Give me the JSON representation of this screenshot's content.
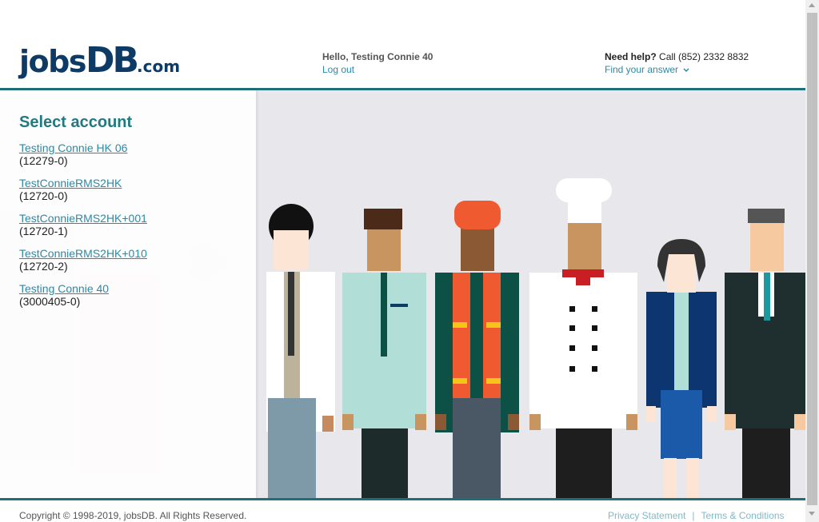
{
  "header": {
    "logo_parts": [
      "jobs",
      "DB",
      ".com"
    ],
    "greeting": "Hello, Testing Connie 40",
    "logout": "Log out",
    "help_label": "Need help?",
    "help_phone": "Call (852) 2332 8832",
    "find_answer": "Find your answer",
    "chevron_icon": "chevron-down-icon"
  },
  "panel": {
    "title": "Select account",
    "accounts": [
      {
        "name": "Testing Connie HK 06",
        "id": "(12279-0)"
      },
      {
        "name": "TestConnieRMS2HK",
        "id": "(12720-0)"
      },
      {
        "name": "TestConnieRMS2HK+001",
        "id": "(12720-1)"
      },
      {
        "name": "TestConnieRMS2HK+010",
        "id": "(12720-2)"
      },
      {
        "name": "Testing Connie 40",
        "id": "(3000405-0)"
      }
    ]
  },
  "footer": {
    "copyright": "Copyright © 1998-2019, jobsDB. All Rights Reserved.",
    "privacy": "Privacy Statement",
    "separator": "|",
    "terms": "Terms & Conditions"
  },
  "colors": {
    "brand_navy": "#0d3b66",
    "accent_teal": "#1f7a82",
    "link_blue": "#2a8aa8"
  }
}
